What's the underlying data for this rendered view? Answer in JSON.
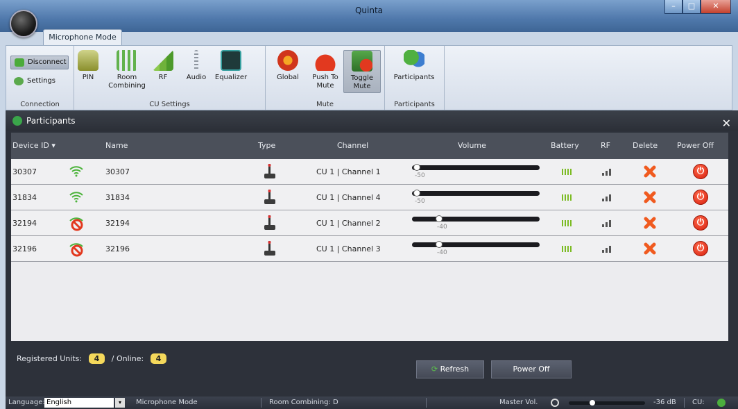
{
  "window": {
    "title": "Quinta",
    "tab": "Microphone Mode"
  },
  "ribbon": {
    "connection": {
      "label": "Connection",
      "disconnect": "Disconnect",
      "settings": "Settings"
    },
    "cu_settings": {
      "label": "CU Settings",
      "pin": "PIN",
      "room": "Room Combining",
      "rf": "RF",
      "audio": "Audio",
      "eq": "Equalizer"
    },
    "mute": {
      "label": "Mute",
      "global": "Global",
      "push": "Push To Mute",
      "toggle": "Toggle Mute"
    },
    "participants": {
      "label": "Participants",
      "btn": "Participants"
    }
  },
  "panel": {
    "title": "Participants",
    "close": "✕",
    "columns": {
      "device_id": "Device ID ▾",
      "name": "Name",
      "type": "Type",
      "channel": "Channel",
      "volume": "Volume",
      "battery": "Battery",
      "rf": "RF",
      "delete": "Delete",
      "power_off": "Power Off"
    },
    "rows": [
      {
        "device_id": "30307",
        "name": "30307",
        "channel": "CU 1 | Channel 1",
        "volume": -50,
        "volume_label": "-50",
        "status": "online"
      },
      {
        "device_id": "31834",
        "name": "31834",
        "channel": "CU 1 | Channel 4",
        "volume": -50,
        "volume_label": "-50",
        "status": "online"
      },
      {
        "device_id": "32194",
        "name": "32194",
        "channel": "CU 1 | Channel 2",
        "volume": -40,
        "volume_label": "-40",
        "status": "muted"
      },
      {
        "device_id": "32196",
        "name": "32196",
        "channel": "CU 1 | Channel 3",
        "volume": -40,
        "volume_label": "-40",
        "status": "muted"
      }
    ],
    "registered_label": "Registered Units:",
    "registered": "4",
    "online_label": "/  Online:",
    "online": "4",
    "refresh": "Refresh",
    "power_off": "Power Off"
  },
  "status": {
    "language_label": "Language:",
    "language": "English",
    "mode": "Microphone Mode",
    "room": "Room Combining: D",
    "master_label": "Master Vol.",
    "master_value": "-36 dB",
    "cu_label": "CU:"
  },
  "colors": {
    "accent_green": "#7cbb24",
    "power_red": "#d61d0b",
    "badge_yellow": "#f4d85b"
  }
}
